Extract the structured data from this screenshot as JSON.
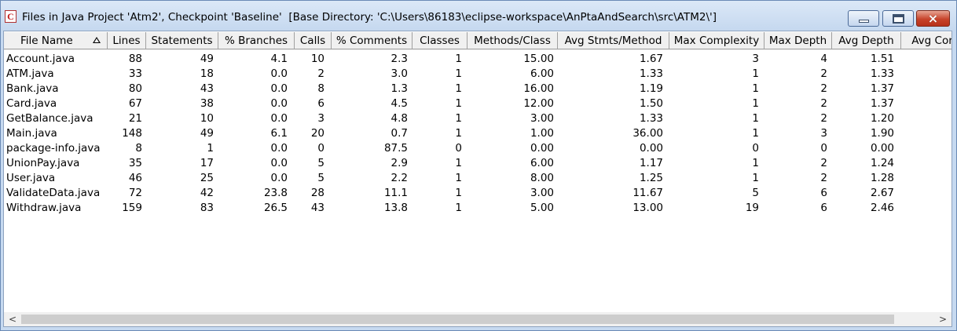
{
  "window": {
    "title": "Files in Java Project 'Atm2', Checkpoint 'Baseline'  [Base Directory: 'C:\\Users\\86183\\eclipse-workspace\\AnPtaAndSearch\\src\\ATM2\\']",
    "app_icon": "C",
    "buttons": {
      "minimize": "minimize-icon",
      "maximize": "maximize-icon",
      "close": "×"
    }
  },
  "table": {
    "columns": [
      "File Name",
      "Lines",
      "Statements",
      "% Branches",
      "Calls",
      "% Comments",
      "Classes",
      "Methods/Class",
      "Avg Stmts/Method",
      "Max Complexity",
      "Max Depth",
      "Avg Depth",
      "Avg Cor"
    ],
    "sorted_column": "File Name",
    "rows": [
      [
        "Account.java",
        "88",
        "49",
        "4.1",
        "10",
        "2.3",
        "1",
        "15.00",
        "1.67",
        "3",
        "4",
        "1.51"
      ],
      [
        "ATM.java",
        "33",
        "18",
        "0.0",
        "2",
        "3.0",
        "1",
        "6.00",
        "1.33",
        "1",
        "2",
        "1.33"
      ],
      [
        "Bank.java",
        "80",
        "43",
        "0.0",
        "8",
        "1.3",
        "1",
        "16.00",
        "1.19",
        "1",
        "2",
        "1.37"
      ],
      [
        "Card.java",
        "67",
        "38",
        "0.0",
        "6",
        "4.5",
        "1",
        "12.00",
        "1.50",
        "1",
        "2",
        "1.37"
      ],
      [
        "GetBalance.java",
        "21",
        "10",
        "0.0",
        "3",
        "4.8",
        "1",
        "3.00",
        "1.33",
        "1",
        "2",
        "1.20"
      ],
      [
        "Main.java",
        "148",
        "49",
        "6.1",
        "20",
        "0.7",
        "1",
        "1.00",
        "36.00",
        "1",
        "3",
        "1.90"
      ],
      [
        "package-info.java",
        "8",
        "1",
        "0.0",
        "0",
        "87.5",
        "0",
        "0.00",
        "0.00",
        "0",
        "0",
        "0.00"
      ],
      [
        "UnionPay.java",
        "35",
        "17",
        "0.0",
        "5",
        "2.9",
        "1",
        "6.00",
        "1.17",
        "1",
        "2",
        "1.24"
      ],
      [
        "User.java",
        "46",
        "25",
        "0.0",
        "5",
        "2.2",
        "1",
        "8.00",
        "1.25",
        "1",
        "2",
        "1.28"
      ],
      [
        "ValidateData.java",
        "72",
        "42",
        "23.8",
        "28",
        "11.1",
        "1",
        "3.00",
        "11.67",
        "5",
        "6",
        "2.67"
      ],
      [
        "Withdraw.java",
        "159",
        "83",
        "26.5",
        "43",
        "13.8",
        "1",
        "5.00",
        "13.00",
        "19",
        "6",
        "2.46"
      ]
    ]
  },
  "scrollbar": {
    "left_arrow": "<",
    "right_arrow": ">"
  }
}
